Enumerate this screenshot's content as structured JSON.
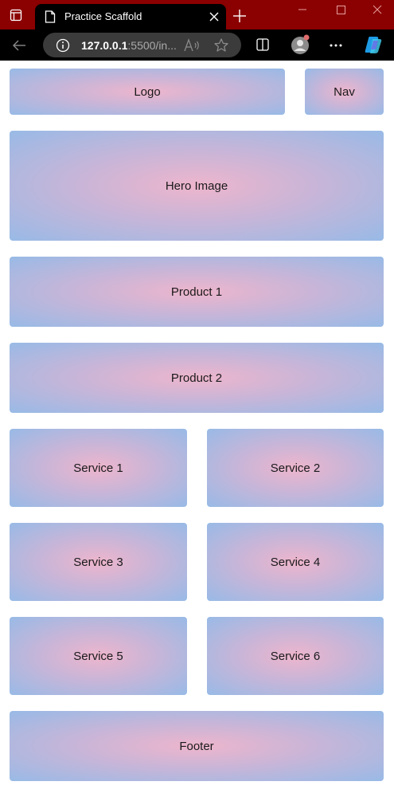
{
  "browser": {
    "tab_title": "Practice Scaffold",
    "url_host": "127.0.0.1",
    "url_rest": ":5500/in..."
  },
  "icons": {
    "tab_actions": "tab-actions-icon",
    "favicon": "page-icon",
    "close": "close-icon",
    "new_tab": "plus-icon",
    "back": "arrow-left-icon",
    "info": "info-icon",
    "read_aloud": "read-aloud-icon",
    "favorite": "star-icon",
    "split": "split-screen-icon",
    "profile": "profile-avatar-icon",
    "more": "more-dots-icon",
    "copilot": "copilot-icon"
  },
  "colors": {
    "titlebar": "#8b0000",
    "toolbar": "#000000",
    "box_center": "#eeb5cc",
    "box_edge": "#98bae6"
  },
  "page": {
    "logo": "Logo",
    "nav": "Nav",
    "hero": "Hero Image",
    "product1": "Product 1",
    "product2": "Product 2",
    "service1": "Service 1",
    "service2": "Service 2",
    "service3": "Service 3",
    "service4": "Service 4",
    "service5": "Service 5",
    "service6": "Service 6",
    "footer": "Footer"
  }
}
